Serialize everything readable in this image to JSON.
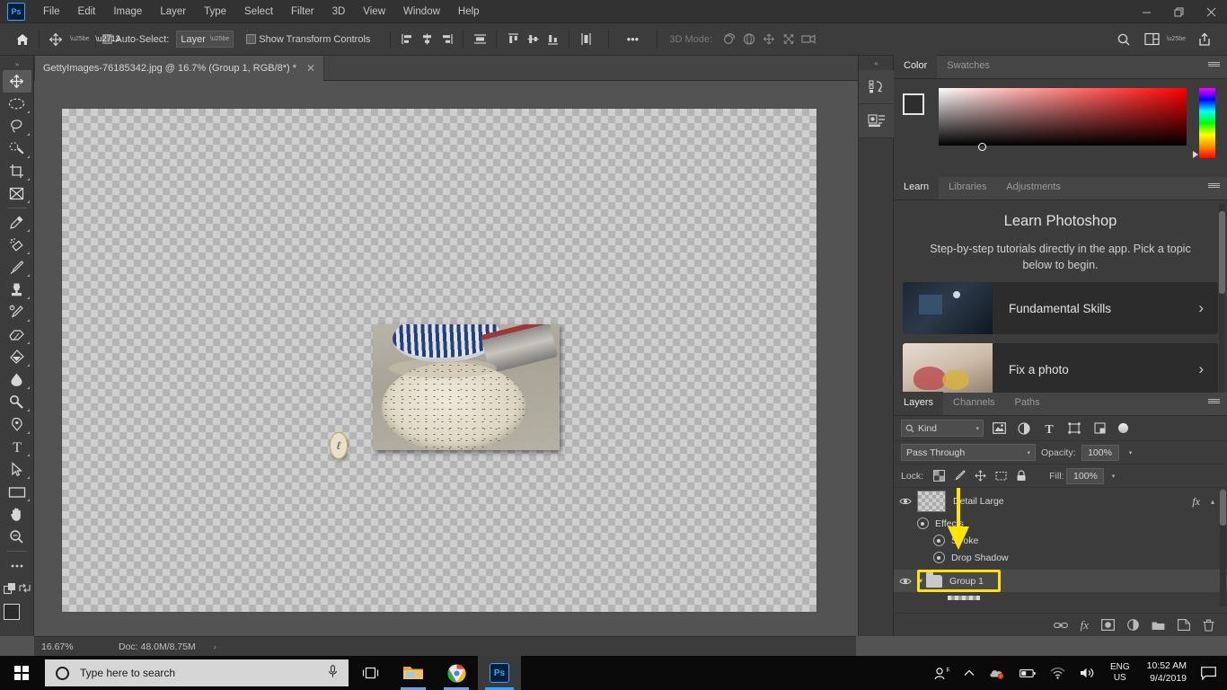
{
  "app": {
    "name": "Adobe Photoshop",
    "logo_text": "Ps"
  },
  "menubar": {
    "items": [
      "File",
      "Edit",
      "Image",
      "Layer",
      "Type",
      "Select",
      "Filter",
      "3D",
      "View",
      "Window",
      "Help"
    ],
    "window_controls": {
      "minimize": "—",
      "maximize": "❐",
      "close": "✕"
    }
  },
  "options_bar": {
    "home_icon": "home-icon",
    "tool_icon": "move-tool-icon",
    "auto_select_label": "Auto-Select:",
    "auto_select_checked": true,
    "layer_select_value": "Layer",
    "show_transform_label": "Show Transform Controls",
    "show_transform_checked": false,
    "more_label": "•••",
    "mode_3d_label": "3D Mode:",
    "search_icon": "search-icon",
    "workspace_icon": "workspace-icon",
    "share_icon": "share-icon"
  },
  "document_tab": {
    "title": "GettyImages-76185342.jpg @ 16.7% (Group 1, RGB/8*) *",
    "close_label": "✕"
  },
  "toolbar": {
    "collapse_label": "»",
    "tools": [
      {
        "name": "move-tool",
        "active": true
      },
      {
        "name": "elliptical-marquee-tool",
        "active": false
      },
      {
        "name": "lasso-tool",
        "active": false
      },
      {
        "name": "quick-selection-tool",
        "active": false
      },
      {
        "name": "crop-tool",
        "active": false
      },
      {
        "name": "frame-tool",
        "active": false
      },
      {
        "name": "eyedropper-tool",
        "active": false
      },
      {
        "name": "spot-healing-brush-tool",
        "active": false
      },
      {
        "name": "brush-tool",
        "active": false
      },
      {
        "name": "clone-stamp-tool",
        "active": false
      },
      {
        "name": "history-brush-tool",
        "active": false
      },
      {
        "name": "eraser-tool",
        "active": false
      },
      {
        "name": "gradient-tool",
        "active": false
      },
      {
        "name": "blur-tool",
        "active": false
      },
      {
        "name": "dodge-tool",
        "active": false
      },
      {
        "name": "pen-tool",
        "active": false
      },
      {
        "name": "type-tool",
        "active": false
      },
      {
        "name": "path-selection-tool",
        "active": false
      },
      {
        "name": "rectangle-tool",
        "active": false
      },
      {
        "name": "hand-tool",
        "active": false
      },
      {
        "name": "zoom-tool",
        "active": false
      },
      {
        "name": "edit-toolbar-tool",
        "active": false
      }
    ],
    "foreground_color": "#2b2b2b",
    "background_color": "#d9d9d9"
  },
  "canvas": {
    "annotation_mark": "ℓ",
    "checkerboard": true
  },
  "status_bar": {
    "zoom": "16.67%",
    "doc_info": "Doc: 48.0M/8.75M",
    "expand_label": "›"
  },
  "mini_dock": {
    "collapse_label": "«",
    "icons": [
      "history-icon",
      "properties-icon"
    ]
  },
  "color_panel": {
    "tabs": [
      {
        "label": "Color",
        "active": true
      },
      {
        "label": "Swatches",
        "active": false
      }
    ],
    "menu_icon": "panel-menu-icon",
    "foreground": "#2e2e2e",
    "background": "#cfcfcf",
    "ramp_hue": "#ff0000"
  },
  "learn_panel": {
    "tabs": [
      {
        "label": "Learn",
        "active": true
      },
      {
        "label": "Libraries",
        "active": false
      },
      {
        "label": "Adjustments",
        "active": false
      }
    ],
    "menu_icon": "panel-menu-icon",
    "title": "Learn Photoshop",
    "subtitle": "Step-by-step tutorials directly in the app. Pick a topic below to begin.",
    "cards": [
      {
        "label": "Fundamental Skills",
        "chevron": "›"
      },
      {
        "label": "Fix a photo",
        "chevron": "›"
      }
    ]
  },
  "layers_panel": {
    "tabs": [
      {
        "label": "Layers",
        "active": true
      },
      {
        "label": "Channels",
        "active": false
      },
      {
        "label": "Paths",
        "active": false
      }
    ],
    "menu_icon": "panel-menu-icon",
    "filter": {
      "kind_label": "Kind",
      "search_icon": "search-icon",
      "filter_icons": [
        "pixel-filter-icon",
        "adjustment-filter-icon",
        "type-filter-icon",
        "shape-filter-icon",
        "smart-object-filter-icon"
      ],
      "toggle_label": "filter-toggle"
    },
    "blend_mode": "Pass Through",
    "opacity_label": "Opacity:",
    "opacity_value": "100%",
    "lock_label": "Lock:",
    "lock_icons": [
      "lock-transparent-pixels-icon",
      "lock-image-pixels-icon",
      "lock-position-icon",
      "lock-artboard-nesting-icon",
      "lock-all-icon"
    ],
    "fill_label": "Fill:",
    "fill_value": "100%",
    "rows": [
      {
        "name": "Detail Large",
        "type": "layer",
        "visible": true,
        "has_fx": true,
        "indent": 0
      },
      {
        "name": "Effects",
        "type": "effects",
        "visible": true,
        "indent": 1
      },
      {
        "name": "Stroke",
        "type": "effect",
        "visible": true,
        "indent": 2
      },
      {
        "name": "Drop Shadow",
        "type": "effect",
        "visible": true,
        "indent": 2
      },
      {
        "name": "Group 1",
        "type": "group",
        "visible": true,
        "selected": true,
        "highlighted": true,
        "indent": 0
      }
    ],
    "fx_label": "fx",
    "bottom_icons": [
      "link-layers-icon",
      "add-layer-style-icon",
      "add-layer-mask-icon",
      "new-fill-adjustment-icon",
      "new-group-icon",
      "new-layer-icon",
      "delete-layer-icon"
    ],
    "bottom_fx_label": "fx"
  },
  "annotation": {
    "highlight_color": "#ffe500",
    "arrow_target": "Group 1"
  },
  "taskbar": {
    "start_label": "start-button",
    "search_placeholder": "Type here to search",
    "mic_icon": "microphone-icon",
    "task_view_icon": "task-view-icon",
    "apps": [
      {
        "name": "file-explorer",
        "open": true
      },
      {
        "name": "google-chrome",
        "open": true
      },
      {
        "name": "photoshop",
        "open": true,
        "active": true
      }
    ],
    "tray": {
      "people_icon": "people-icon",
      "chevron_icon": "show-hidden-icons-icon",
      "onedrive_icon": "onedrive-icon",
      "battery_icon": "battery-icon",
      "network_icon": "wifi-icon",
      "volume_icon": "volume-icon",
      "language_line1": "ENG",
      "language_line2": "US",
      "time": "10:52 AM",
      "date": "9/4/2019",
      "notification_icon": "action-center-icon"
    }
  }
}
